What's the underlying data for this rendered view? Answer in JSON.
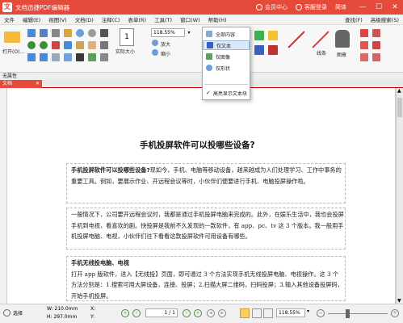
{
  "titlebar": {
    "app_icon": "文",
    "title": "文档迅捷PDF编辑器",
    "member": "会员中心",
    "login": "客服登录",
    "lang": "简体"
  },
  "menubar": {
    "items": [
      "文件",
      "编辑(E)",
      "视图(V)",
      "文档(D)",
      "注释(C)",
      "表单(R)",
      "工具(T)",
      "窗口(W)",
      "帮助(H)"
    ],
    "find": "查找(F)",
    "advanced_find": "高级搜索(S)"
  },
  "toolbar": {
    "open": "打开(O)...",
    "actual_size": "实际大小",
    "zoom_value": "118.55%",
    "zoom_in": "放大",
    "zoom_out": "缩小",
    "line_shape": "线条",
    "stamp": "图章"
  },
  "statusrow": {
    "text": "无属性"
  },
  "tab": {
    "label": "文档"
  },
  "dropdown": {
    "items": [
      {
        "label": "全部内容",
        "selected": false
      },
      {
        "label": "仅文本",
        "selected": true
      },
      {
        "label": "仅图像",
        "selected": false
      },
      {
        "label": "仅形状",
        "selected": false
      }
    ],
    "highlight_label": "高亮显示文本块"
  },
  "document": {
    "title": "手机投屏软件可以投哪些设备?",
    "p1_lead": "手机投屏软件可以投哪些设备?",
    "p1_rest": "现如今，手机、电脑等移动设备，越来越成为人们处理学习、工作中事务的重要工具。例如，要展示作业、开远程会议等时，小伙伴们便要进行手机、电脑投屏操作啦。",
    "p2": "一般情况下，公司要开远程会议时，我都是通过手机投屏电脑来完成的。此外，在娱乐生活中，我也会投屏手机到电视，看喜欢的剧。快投屏是我前不久发现的一款软件，有 app、pc、tv 这 3 个版本。我一般用手机投屏电脑、电视，小伙伴们往下看看这款投屏软件可用设备有哪些。",
    "p3_heading": "手机无线投电脑、电视",
    "p3_body": "打开 app 版软件，进入【无线投】页面，即可通过 3 个方法实现手机无线投屏电脑、电视操作。这 3 个方法分别是：1.搜索可用大屏设备，连接、投屏；2.扫描大屏二维码，扫码投屏；3.输入其他设备投屏码，开始手机投屏。"
  },
  "bottombar": {
    "select_label": "选择",
    "width": "W: 210.0mm",
    "height": "H: 297.0mm",
    "x": "X:",
    "y": "Y:",
    "page": "1 / 1",
    "zoom": "118.55%"
  }
}
